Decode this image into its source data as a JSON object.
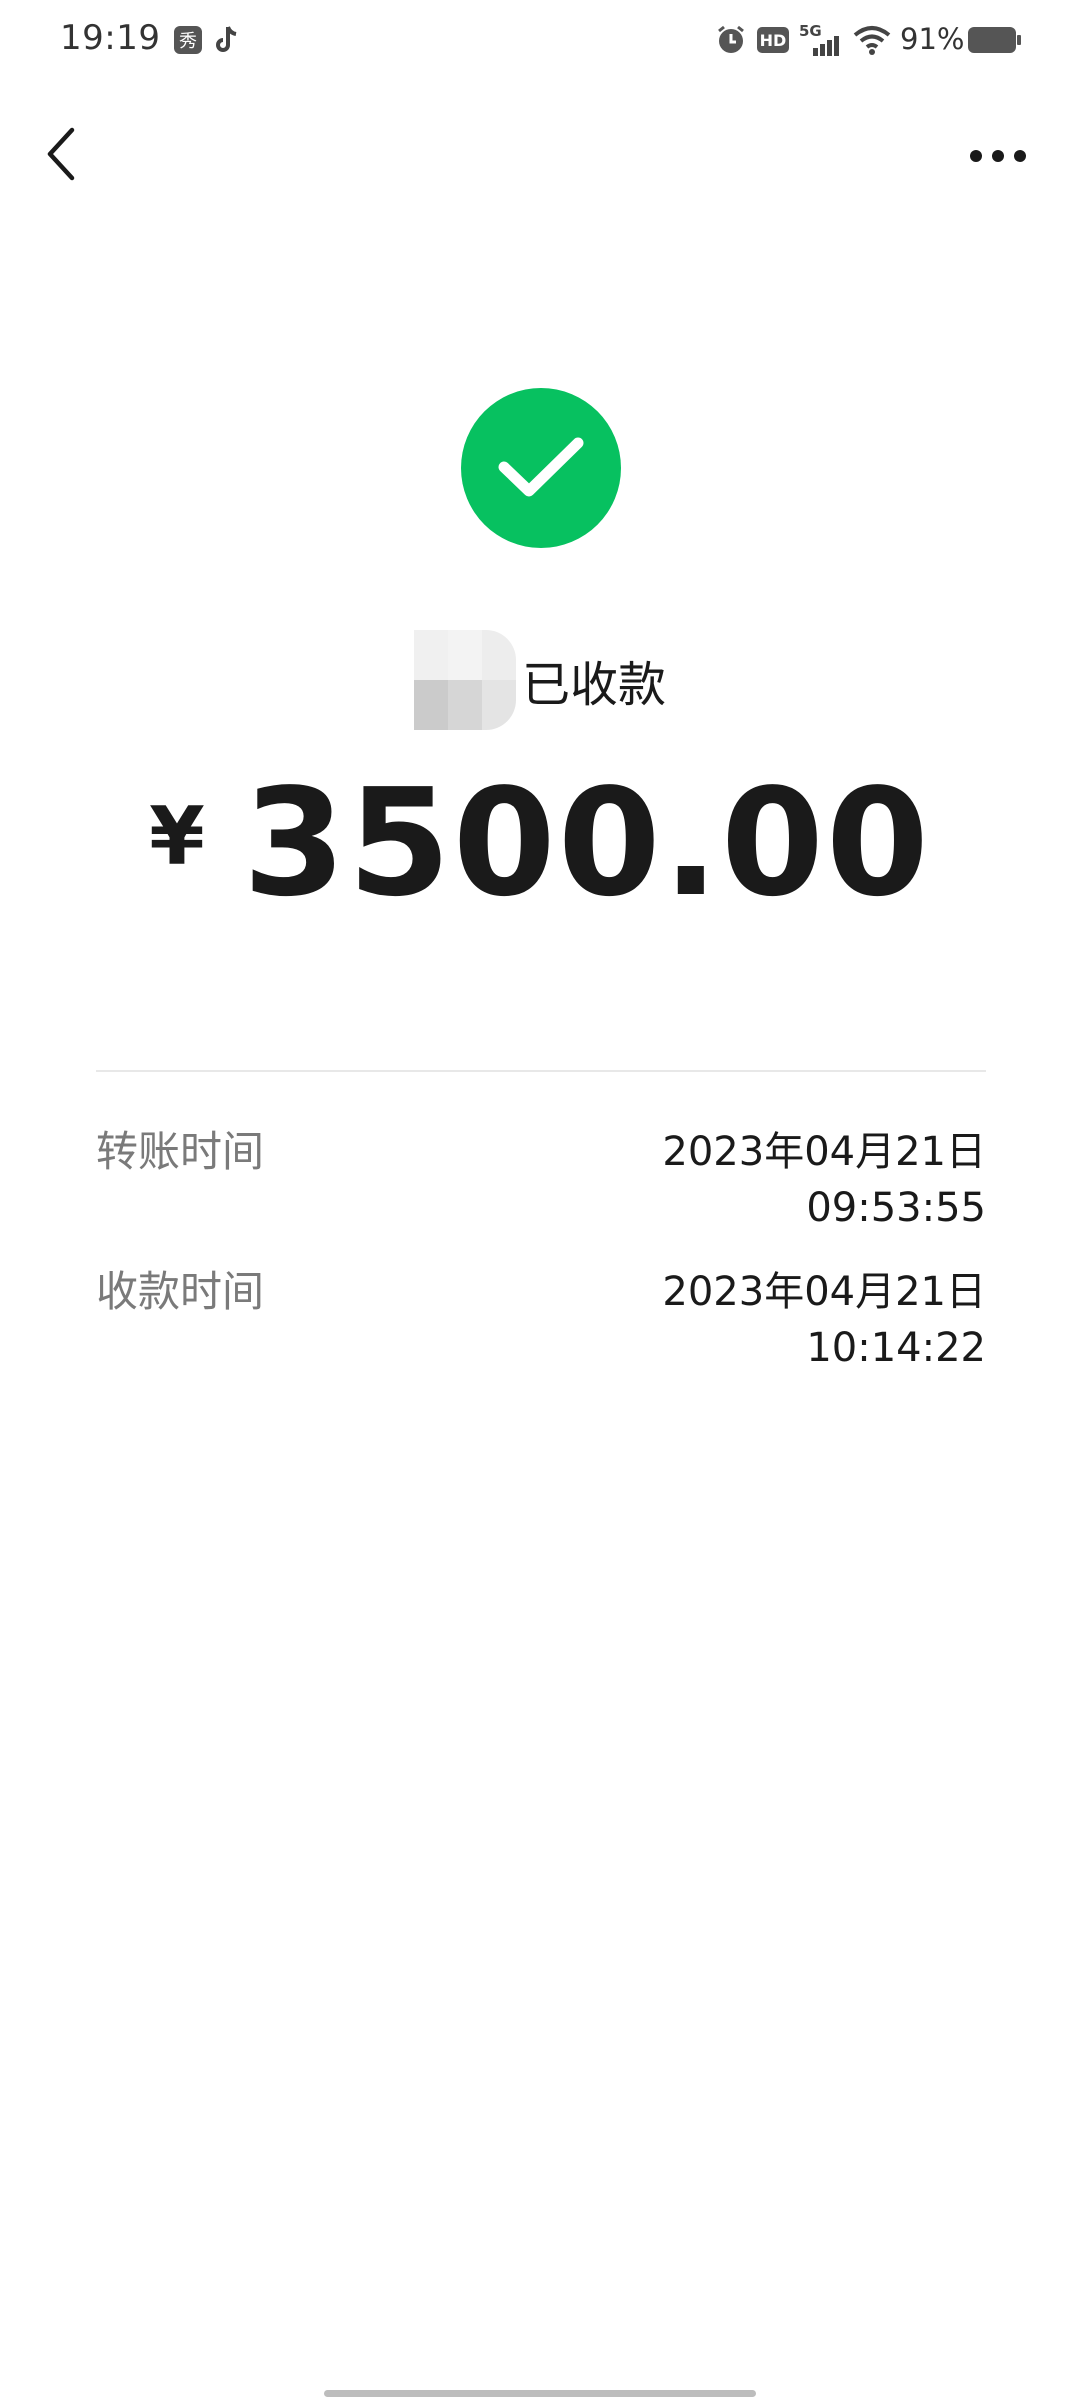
{
  "status_bar": {
    "time": "19:19",
    "network": "5G",
    "hd_label": "HD",
    "battery": "91%",
    "app_icons": [
      "xiu-app-icon",
      "tiktok-icon"
    ],
    "system_icons": [
      "alarm-icon",
      "hd-icon",
      "5g-signal-icon",
      "wifi-icon",
      "battery-icon"
    ]
  },
  "nav": {
    "back_icon": "chevron-left-icon",
    "more_icon": "more-dots-icon"
  },
  "receipt": {
    "status_icon": "check-icon",
    "status_color": "#07c160",
    "status_text": "已收款",
    "currency": "¥",
    "amount": "3500.00"
  },
  "details": [
    {
      "label": "转账时间",
      "date": "2023年04月21日",
      "time": "09:53:55"
    },
    {
      "label": "收款时间",
      "date": "2023年04月21日",
      "time": "10:14:22"
    }
  ]
}
